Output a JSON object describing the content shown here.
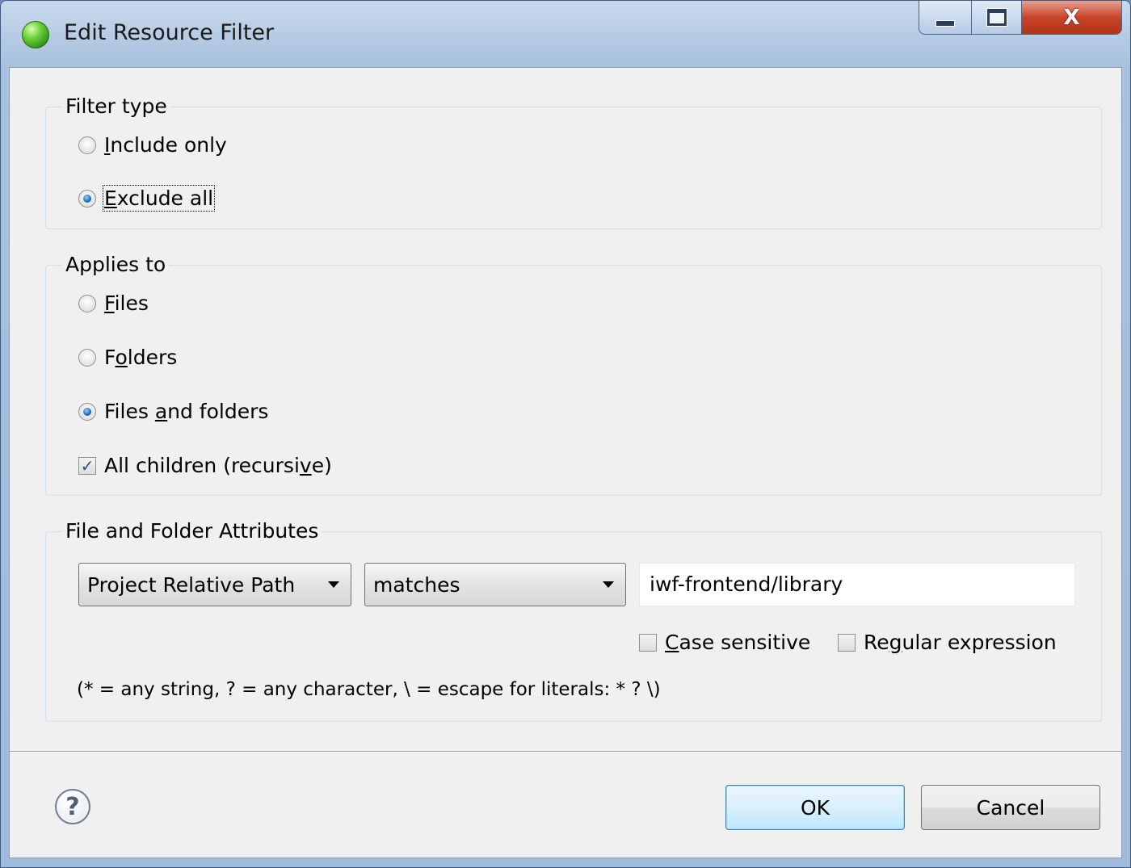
{
  "window": {
    "title": "Edit Resource Filter",
    "controls": {
      "minimize": "minimize",
      "maximize": "maximize",
      "close": "X"
    }
  },
  "filter_type": {
    "label": "Filter type",
    "options": [
      {
        "pre": "",
        "key": "I",
        "post": "nclude only",
        "checked": false
      },
      {
        "pre": "",
        "key": "E",
        "post": "xclude all",
        "checked": true
      }
    ]
  },
  "applies_to": {
    "label": "Applies to",
    "options": [
      {
        "pre": "",
        "key": "F",
        "post": "iles",
        "checked": false
      },
      {
        "pre": "F",
        "key": "o",
        "post": "lders",
        "checked": false
      },
      {
        "pre": "Files ",
        "key": "a",
        "post": "nd folders",
        "checked": true
      }
    ],
    "recursive": {
      "pre": "All children (recursi",
      "key": "v",
      "post": "e)",
      "checked": true
    }
  },
  "attributes": {
    "label": "File and Folder Attributes",
    "attribute_select": "Project Relative Path",
    "operator_select": "matches",
    "value": "iwf-frontend/library",
    "case_sensitive": {
      "pre": "",
      "key": "C",
      "post": "ase sensitive",
      "checked": false
    },
    "regex": {
      "pre": "Re",
      "key": "g",
      "post": "ular expression",
      "checked": false
    },
    "hint": "(* = any string, ? = any character, \\ = escape for literals: * ? \\)"
  },
  "footer": {
    "help": "?",
    "ok": "OK",
    "cancel": "Cancel"
  },
  "icons": {
    "app": "eclipse-icon",
    "help": "help-icon",
    "dropdown": "chevron-down-icon",
    "check": "checkmark-icon"
  }
}
